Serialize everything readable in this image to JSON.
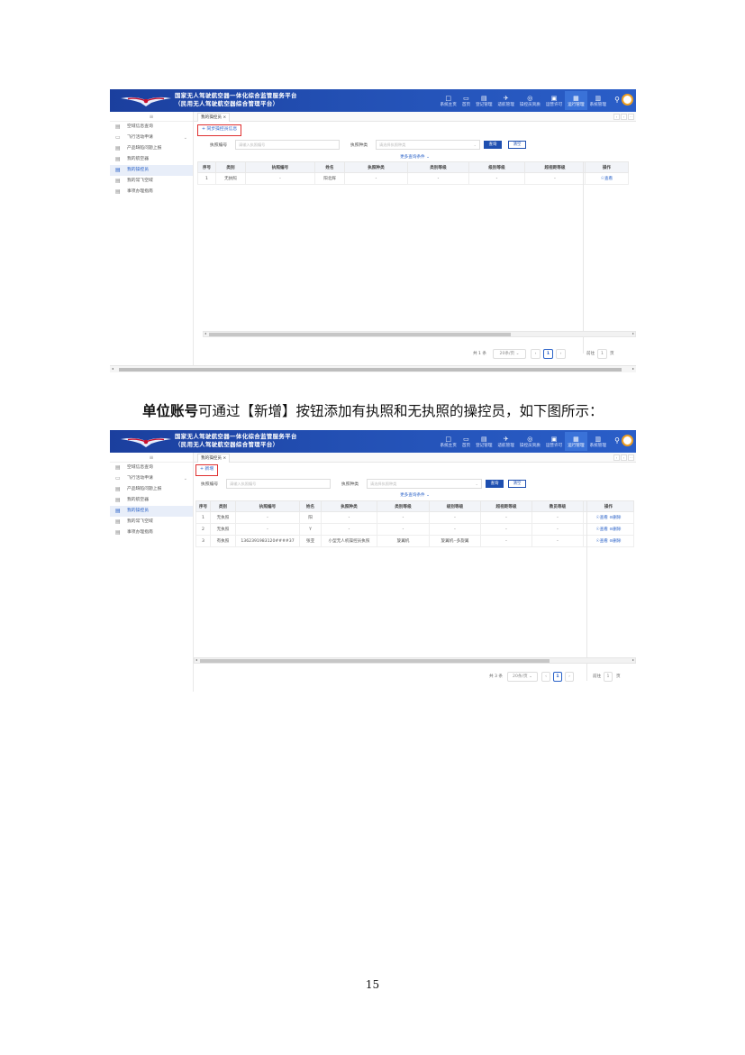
{
  "header": {
    "title_line1": "国家无人驾驶航空器一体化综合监管服务平台",
    "title_line2": "（民用无人驾驶航空器综合管理平台）",
    "nav": [
      {
        "label": "系统主页",
        "icon": "□"
      },
      {
        "label": "首页",
        "icon": "▭"
      },
      {
        "label": "登记管理",
        "icon": "▤"
      },
      {
        "label": "适航管理",
        "icon": "✈"
      },
      {
        "label": "操控员资质",
        "icon": "◎"
      },
      {
        "label": "运营许可",
        "icon": "▣"
      },
      {
        "label": "运行管理",
        "icon": "▦"
      },
      {
        "label": "系统管理",
        "icon": "▥"
      }
    ],
    "active_nav": "运行管理",
    "menu_icon": "≡"
  },
  "sidebar": {
    "items": [
      {
        "label": "空域信息查询",
        "icon": "▤"
      },
      {
        "label": "飞行活动申请",
        "icon": "▭",
        "expandable": true
      },
      {
        "label": "产品缺陷问题上报",
        "icon": "▤"
      },
      {
        "label": "我的航空器",
        "icon": "▤"
      },
      {
        "label": "我的操控员",
        "icon": "▤",
        "active": true
      },
      {
        "label": "我的常飞空域",
        "icon": "▤"
      },
      {
        "label": "事项办理指南",
        "icon": "▤"
      }
    ]
  },
  "tab": {
    "label": "我的操控员 ×"
  },
  "filters": {
    "license_no_label": "执照编号",
    "license_no_placeholder": "请输入执照编号",
    "license_type_label": "执照种类",
    "license_type_placeholder": "请选择执照种类",
    "query_label": "查询",
    "reset_label": "清空",
    "more_label": "更多查询条件 ⌄"
  },
  "table": {
    "headers1": [
      "序号",
      "类别",
      "执照编号",
      "姓名",
      "执照种类",
      "类别等级",
      "级别等级",
      "超视距等级",
      "操作"
    ],
    "headers2": [
      "序号",
      "类别",
      "执照编号",
      "姓名",
      "执照种类",
      "类别等级",
      "级别等级",
      "超视距等级",
      "教员等级",
      "操作"
    ],
    "view_label": "☉查看",
    "delete_label": "⊝删除"
  },
  "screenshot1": {
    "action_label": "+ 同步操控员信息",
    "rows": [
      {
        "no": "1",
        "category": "无执照",
        "license_no": "-",
        "name": "阳北辉",
        "type": "-",
        "class": "-",
        "level": "-",
        "bvlos": "-"
      }
    ],
    "pager": {
      "total": "共 1 条",
      "page_size": "20条/页",
      "current": "1",
      "goto_label": "前往",
      "goto_value": "1",
      "page_unit": "页"
    }
  },
  "screenshot2": {
    "action_label": "+ 新增",
    "rows": [
      {
        "no": "1",
        "category": "无执照",
        "license_no": "-",
        "name": "阳",
        "type": "-",
        "class": "-",
        "level": "-",
        "bvlos": "-",
        "instructor": "-"
      },
      {
        "no": "2",
        "category": "无执照",
        "license_no": "-",
        "name": "Y",
        "type": "-",
        "class": "-",
        "level": "-",
        "bvlos": "-",
        "instructor": "-"
      },
      {
        "no": "3",
        "category": "有执照",
        "license_no": "1362391983120####37",
        "name": "张亚",
        "type": "小型无人机操控员执照",
        "class": "旋翼机",
        "level": "旋翼机--多旋翼",
        "bvlos": "-",
        "instructor": "-"
      }
    ],
    "pager": {
      "total": "共 3 条",
      "page_size": "20条/页",
      "current": "1",
      "goto_label": "前往",
      "goto_value": "1",
      "page_unit": "页"
    }
  },
  "caption": {
    "bold": "单位账号",
    "rest": "可通过【新增】按钮添加有执照和无执照的操控员，如下图所示："
  },
  "page_number": "15"
}
